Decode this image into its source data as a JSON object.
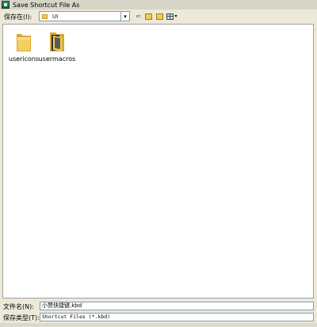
{
  "window": {
    "title": "Save Shortcut File As",
    "app_icon": "app-icon"
  },
  "toolbar": {
    "save_in_label": "保存在(I):",
    "location": "UI",
    "dropdown_arrow": "▾",
    "back_glyph": "⇐",
    "view_dropdown_glyph": "▾"
  },
  "files": [
    {
      "name": "usericons",
      "icon": "folder-icon"
    },
    {
      "name": "usermacros",
      "icon": "folder-open-icon"
    }
  ],
  "filename": {
    "label": "文件名(N):",
    "value": "小赞快捷键.kbd"
  },
  "filetype": {
    "label": "保存类型(T):",
    "value": "Shortcut Files (*.kbd)"
  },
  "colors": {
    "folder": "#f1c95a",
    "folder_dark": "#c99a25",
    "dialog_bg": "#ece9d8"
  }
}
